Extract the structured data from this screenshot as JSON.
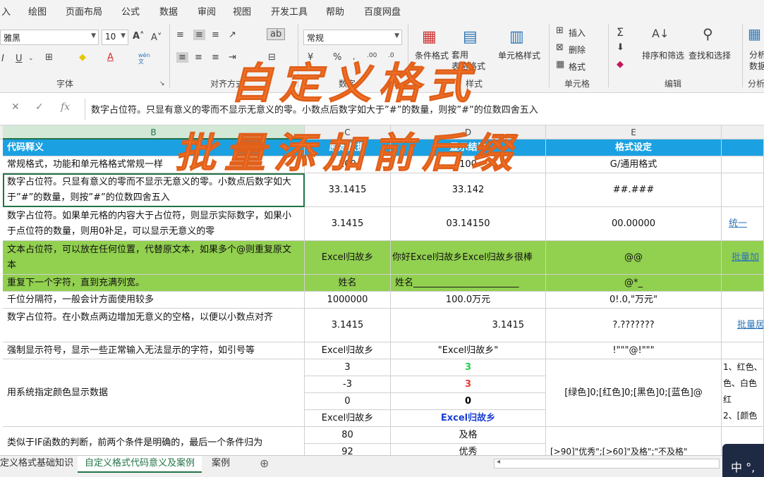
{
  "ribbon_tabs": [
    "入",
    "绘图",
    "页面布局",
    "公式",
    "数据",
    "审阅",
    "视图",
    "开发工具",
    "帮助",
    "百度网盘"
  ],
  "ribbon": {
    "font_name": "雅黑",
    "font_size": "10",
    "number_format": "常规",
    "font_group": "字体",
    "align_group": "对齐方式",
    "number_group": "数字",
    "style_group": "样式",
    "cells_group": "单元格",
    "edit_group": "编辑",
    "analysis_group": "分析",
    "cond_format": "条件格式",
    "table_format": "套用\n表格格式",
    "cell_style": "单元格样式",
    "insert": "插入",
    "delete": "删除",
    "format": "格式",
    "sort_filter": "排序和筛选",
    "find_select": "查找和选择",
    "analyze": "分析\n数据",
    "phonetic": "wén\n文"
  },
  "formula_bar": {
    "content": "数字占位符。只显有意义的零而不显示无意义的零。小数点后数字如大于”#”的数量，则按”#”的位数四舍五入"
  },
  "columns": [
    "B",
    "C",
    "D",
    "E"
  ],
  "header": {
    "b": "代码释义",
    "c": "原始数据",
    "d": "显示结果",
    "e": "格式设定"
  },
  "rows": {
    "r1": {
      "b": "常规格式，功能和单元格格式常规一样",
      "c": "100",
      "d": "100",
      "e": "G/通用格式"
    },
    "r2": {
      "b": "数字占位符。只显有意义的零而不显示无意义的零。小数点后数字如大于”#”的数量，则按”#”的位数四舍五入",
      "c": "33.1415",
      "d": "33.142",
      "e": "##.###"
    },
    "r3": {
      "b": "数字占位符。如果单元格的内容大于占位符，则显示实际数字，如果小于点位符的数量，则用0补足，可以显示无意义的零",
      "c": "3.1415",
      "d": "03.14150",
      "e": "00.00000",
      "f": "统一"
    },
    "r4": {
      "b": "文本占位符，可以放在任何位置，代替原文本，如果多个@则重复原文本",
      "c": "Excel归故乡",
      "d": "你好Excel归故乡Excel归故乡很棒",
      "e": "@@",
      "f": "批量加"
    },
    "r5": {
      "b": "重复下一个字符，直到充满列宽。",
      "c": "姓名",
      "d": "姓名_______________________",
      "e": "@*_"
    },
    "r6": {
      "b": "千位分隔符，一般会计方面使用较多",
      "c": "1000000",
      "d": "100.0万元",
      "e": "0!.0,\"万元\""
    },
    "r7": {
      "b": "数字占位符。在小数点两边增加无意义的空格，以便以小数点对齐",
      "c": "3.1415",
      "d": "3.1415",
      "e": "?.???????",
      "f": "批量居"
    },
    "r8": {
      "b": "强制显示符号，显示一些正常输入无法显示的字符，如引号等",
      "c": "Excel归故乡",
      "d": "\"Excel归故乡\"",
      "e": "!\"\"\"@!\"\"\""
    },
    "r9": {
      "b": "用系统指定颜色显示数据",
      "c1": "3",
      "d1": "3",
      "c2": "-3",
      "d2": "3",
      "c3": "0",
      "d3": "0",
      "c4": "Excel归故乡",
      "d4": "Excel归故乡",
      "e": "[绿色]0;[红色]0;[黑色]0;[蓝色]@",
      "f": "1、红色、\n色、白色\n红\n2、[颜色"
    },
    "r10": {
      "b": "类似于IF函数的判断，前两个条件是明确的，最后一个条件归为",
      "c1": "80",
      "d1": "及格",
      "c2": "92",
      "d2": "优秀",
      "e": "[>90]\"优秀\";[>60]\"及格\";\"不及格\""
    }
  },
  "colors": {
    "green_value": "#1fcf4f",
    "red_value": "#e53935",
    "blue_value": "#1a3fd6",
    "header_blue": "#1ba1e2",
    "row_green": "#92d050",
    "overlay_orange": "#f4742a"
  },
  "sheet_tabs": [
    "定义格式基础知识",
    "自定义格式代码意义及案例",
    "案例"
  ],
  "overlay": {
    "title1": "自定义格式",
    "title2": "批量添加前后缀"
  },
  "ime": {
    "label": "中 °,"
  }
}
